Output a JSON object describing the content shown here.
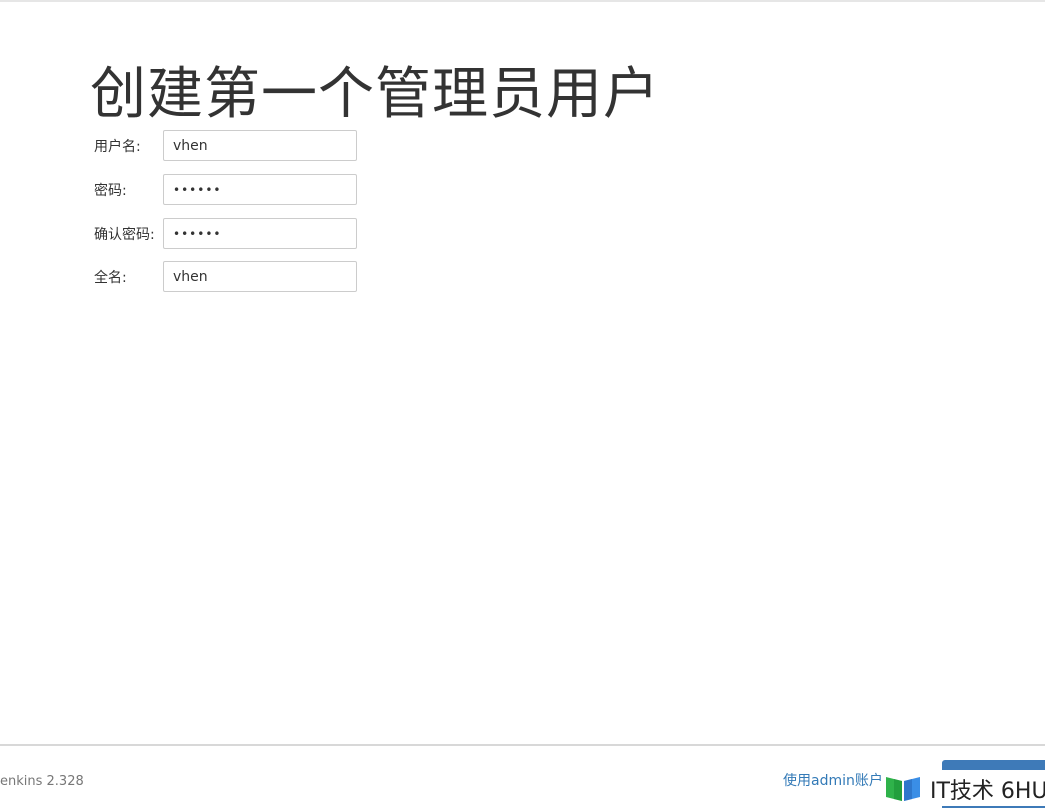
{
  "page": {
    "title": "创建第一个管理员用户"
  },
  "form": {
    "username": {
      "label": "用户名:",
      "value": "vhen"
    },
    "password": {
      "label": "密码:",
      "value": "••••••"
    },
    "confirm_password": {
      "label": "确认密码:",
      "value": "••••••"
    },
    "fullname": {
      "label": "全名:",
      "value": "vhen"
    }
  },
  "footer": {
    "version": "enkins 2.328",
    "admin_link": "使用admin账户",
    "button_label": ""
  },
  "watermark": {
    "text": "IT技术 6HU",
    "icon": "colored-book-logo"
  },
  "colors": {
    "primary": "#3e7ab8",
    "link": "#337ab7"
  }
}
